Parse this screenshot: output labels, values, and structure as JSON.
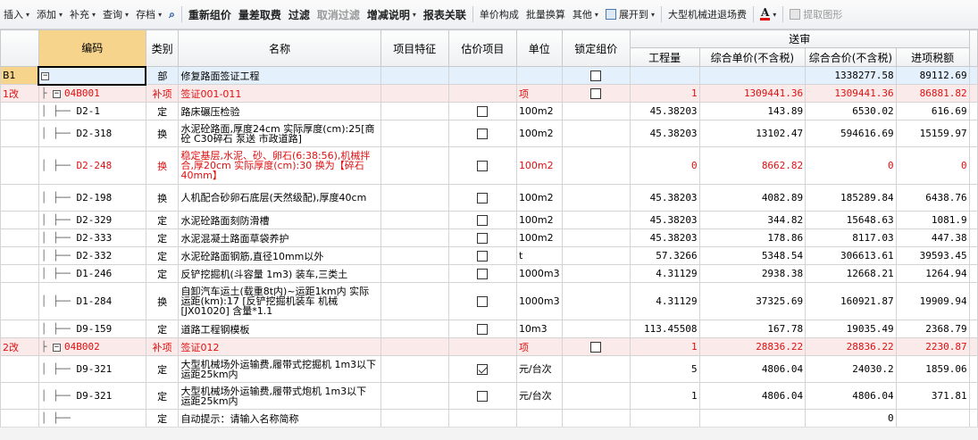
{
  "toolbar": {
    "items": [
      {
        "label": "插入",
        "menu": true
      },
      {
        "label": "添加",
        "menu": true
      },
      {
        "label": "补充",
        "menu": true
      },
      {
        "label": "查询",
        "menu": true
      },
      {
        "label": "存档",
        "menu": true
      }
    ],
    "find_icon": "binoculars-icon",
    "recalc": "重新组价",
    "diff": "量差取费",
    "filter": "过滤",
    "cancel_filter": "取消过滤",
    "inc_desc": "增减说明",
    "report_link": "报表关联",
    "unit_price_comp": "单价构成",
    "batch_convert": "批量换算",
    "other": "其他",
    "expand_to": "展开到",
    "large_machine": "大型机械进退场费",
    "font_color_icon": "A",
    "extract_graph": "提取图形"
  },
  "table": {
    "headers": {
      "code": "编码",
      "type": "类别",
      "name": "名称",
      "feature": "项目特征",
      "estimate": "估价项目",
      "unit": "单位",
      "lock": "锁定组价",
      "group": "送审",
      "qty": "工程量",
      "unit_price": "综合单价(不含税)",
      "total": "综合合价(不含税)",
      "tax": "进项税额"
    },
    "rows": [
      {
        "rowhead": "B1",
        "code": "",
        "type": "部",
        "name": "修复路面签证工程",
        "feature": "",
        "est": null,
        "unit": "",
        "lock": false,
        "qty": "",
        "up": "",
        "total": "1338277.58",
        "tax": "89112.69",
        "style": "b1"
      },
      {
        "rowhead": "1改",
        "code": "04B001",
        "type": "补项",
        "name": "签证001-011",
        "feature": "",
        "est": null,
        "unit": "项",
        "lock": false,
        "qty": "1",
        "up": "1309441.36",
        "total": "1309441.36",
        "tax": "86881.82",
        "style": "sec"
      },
      {
        "rowhead": "",
        "code": "D2-1",
        "type": "定",
        "name": "路床碾压检验",
        "feature": "",
        "est": false,
        "unit": "100m2",
        "lock": null,
        "qty": "45.38203",
        "up": "143.89",
        "total": "6530.02",
        "tax": "616.69",
        "style": "n"
      },
      {
        "rowhead": "",
        "code": "D2-318",
        "type": "换",
        "name": "水泥砼路面,厚度24cm  实际厚度(cm):25[商砼 C30碎石 泵送 市政道路]",
        "feature": "",
        "est": false,
        "unit": "100m2",
        "lock": null,
        "qty": "45.38203",
        "up": "13102.47",
        "total": "594616.69",
        "tax": "15159.97",
        "style": "n2"
      },
      {
        "rowhead": "",
        "code": "D2-248",
        "type": "换",
        "name": "稳定基层,水泥、砂、卵石(6:38:56),机械拌合,厚20cm  实际厚度(cm):30  换为【碎石40mm】",
        "feature": "",
        "est": false,
        "unit": "100m2",
        "lock": null,
        "qty": "0",
        "up": "8662.82",
        "total": "0",
        "tax": "0",
        "style": "redn3"
      },
      {
        "rowhead": "",
        "code": "D2-198",
        "type": "换",
        "name": "人机配合砂卵石底层(天然级配),厚度40cm",
        "feature": "",
        "est": false,
        "unit": "100m2",
        "lock": null,
        "qty": "45.38203",
        "up": "4082.89",
        "total": "185289.84",
        "tax": "6438.76",
        "style": "n2"
      },
      {
        "rowhead": "",
        "code": "D2-329",
        "type": "定",
        "name": "水泥砼路面刻防滑槽",
        "feature": "",
        "est": false,
        "unit": "100m2",
        "lock": null,
        "qty": "45.38203",
        "up": "344.82",
        "total": "15648.63",
        "tax": "1081.9",
        "style": "n"
      },
      {
        "rowhead": "",
        "code": "D2-333",
        "type": "定",
        "name": "水泥混凝土路面草袋养护",
        "feature": "",
        "est": false,
        "unit": "100m2",
        "lock": null,
        "qty": "45.38203",
        "up": "178.86",
        "total": "8117.03",
        "tax": "447.38",
        "style": "n"
      },
      {
        "rowhead": "",
        "code": "D2-332",
        "type": "定",
        "name": "水泥砼路面钢筋,直径10mm以外",
        "feature": "",
        "est": false,
        "unit": "t",
        "lock": null,
        "qty": "57.3266",
        "up": "5348.54",
        "total": "306613.61",
        "tax": "39593.45",
        "style": "n"
      },
      {
        "rowhead": "",
        "code": "D1-246",
        "type": "定",
        "name": "反铲挖掘机(斗容量 1m3) 装车,三类土",
        "feature": "",
        "est": false,
        "unit": "1000m3",
        "lock": null,
        "qty": "4.31129",
        "up": "2938.38",
        "total": "12668.21",
        "tax": "1264.94",
        "style": "n"
      },
      {
        "rowhead": "",
        "code": "D1-284",
        "type": "换",
        "name": "自卸汽车运土(载重8t内)~运距1km内  实际运距(km):17  [反铲挖掘机装车 机械[JX01020] 含量*1.1",
        "feature": "",
        "est": false,
        "unit": "1000m3",
        "lock": null,
        "qty": "4.31129",
        "up": "37325.69",
        "total": "160921.87",
        "tax": "19909.94",
        "style": "n3"
      },
      {
        "rowhead": "",
        "code": "D9-159",
        "type": "定",
        "name": "道路工程钢模板",
        "feature": "",
        "est": false,
        "unit": "10m3",
        "lock": null,
        "qty": "113.45508",
        "up": "167.78",
        "total": "19035.49",
        "tax": "2368.79",
        "style": "n"
      },
      {
        "rowhead": "2改",
        "code": "04B002",
        "type": "补项",
        "name": "签证012",
        "feature": "",
        "est": null,
        "unit": "项",
        "lock": false,
        "qty": "1",
        "up": "28836.22",
        "total": "28836.22",
        "tax": "2230.87",
        "style": "sec"
      },
      {
        "rowhead": "",
        "code": "D9-321",
        "type": "定",
        "name": "大型机械场外运输费,履带式挖掘机 1m3以下 运距25km内",
        "feature": "",
        "est": true,
        "unit": "元/台次",
        "lock": null,
        "qty": "5",
        "up": "4806.04",
        "total": "24030.2",
        "tax": "1859.06",
        "style": "n2"
      },
      {
        "rowhead": "",
        "code": "D9-321",
        "type": "定",
        "name": "大型机械场外运输费,履带式炮机 1m3以下 运距25km内",
        "feature": "",
        "est": false,
        "unit": "元/台次",
        "lock": null,
        "qty": "1",
        "up": "4806.04",
        "total": "4806.04",
        "tax": "371.81",
        "style": "n2"
      },
      {
        "rowhead": "",
        "code": "",
        "type": "定",
        "name": "自动提示：请输入名称简称",
        "feature": "",
        "est": null,
        "unit": "",
        "lock": null,
        "qty": "",
        "up": "",
        "total": "0",
        "tax": "",
        "style": "n"
      }
    ]
  }
}
